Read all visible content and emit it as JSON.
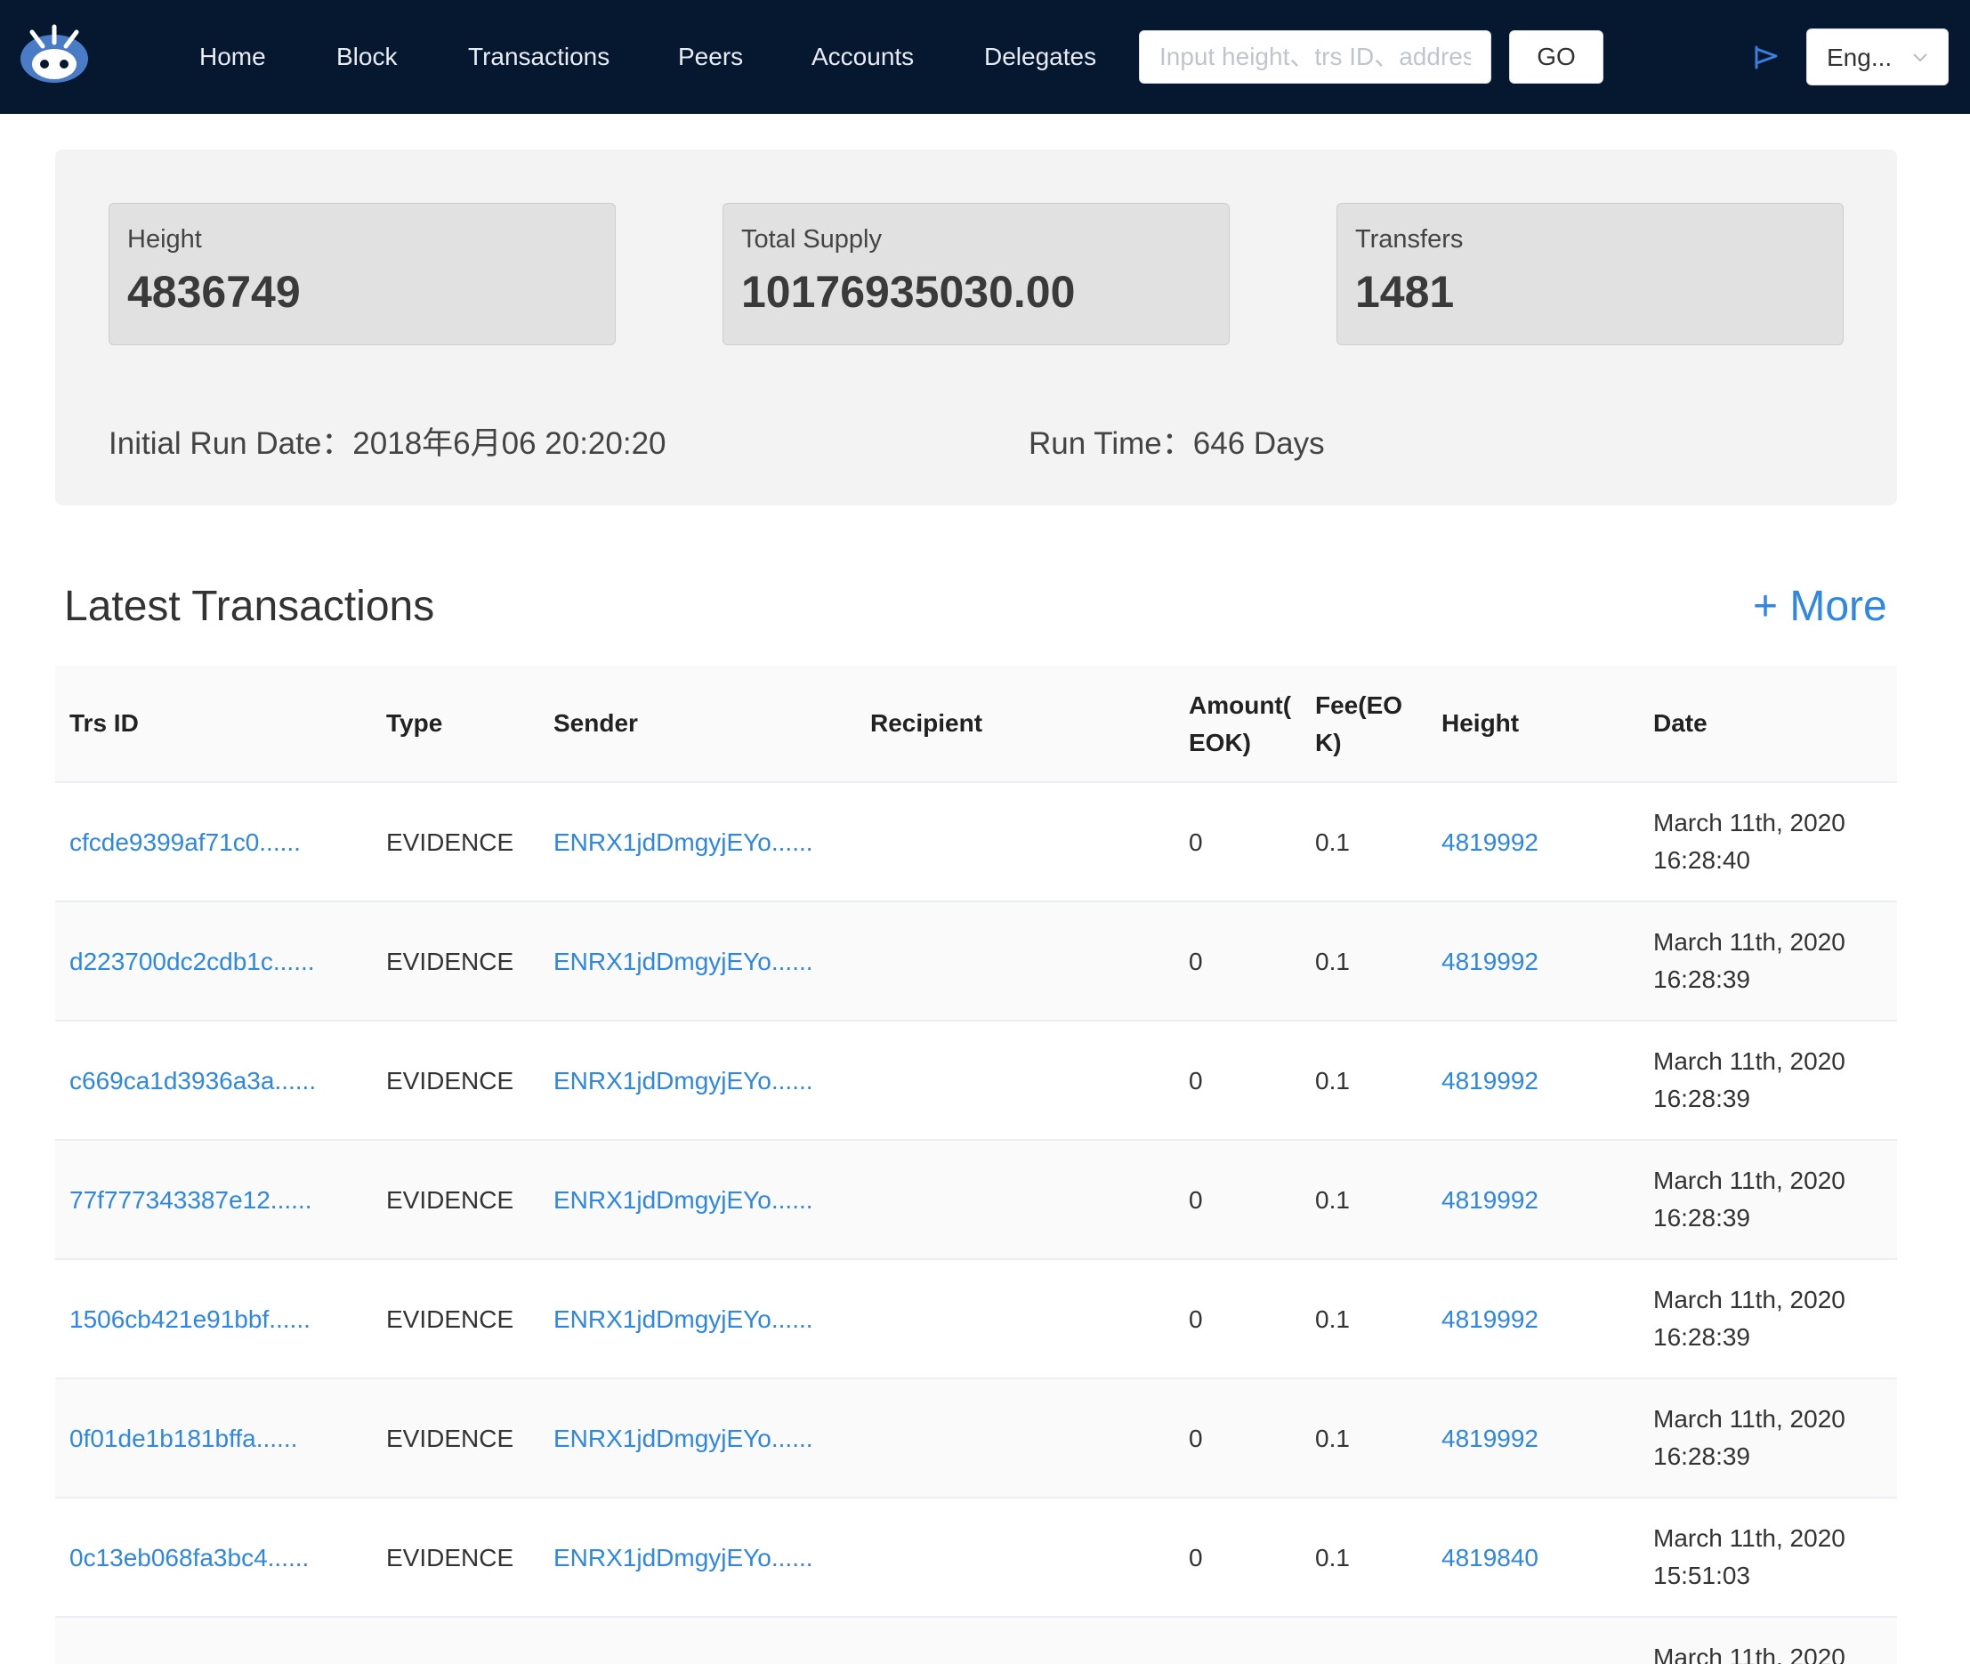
{
  "nav": {
    "items": [
      "Home",
      "Block",
      "Transactions",
      "Peers",
      "Accounts",
      "Delegates"
    ],
    "search_placeholder": "Input height、trs ID、address",
    "go_label": "GO",
    "language": "Eng..."
  },
  "stats": {
    "height_label": "Height",
    "height_value": "4836749",
    "supply_label": "Total Supply",
    "supply_value": "10176935030.00",
    "transfers_label": "Transfers",
    "transfers_value": "1481",
    "initial_run_label": "Initial Run Date：",
    "initial_run_value": "2018年6月06 20:20:20",
    "run_time_label": "Run Time：",
    "run_time_value": "646 Days"
  },
  "transactions": {
    "title": "Latest Transactions",
    "more_label": "+ More",
    "headers": {
      "trs_id": "Trs ID",
      "type": "Type",
      "sender": "Sender",
      "recipient": "Recipient",
      "amount_line1": "Amount(",
      "amount_line2": "EOK)",
      "fee_line1": "Fee(EO",
      "fee_line2": "K)",
      "height": "Height",
      "date": "Date"
    },
    "rows": [
      {
        "id": "cfcde9399af71c0......",
        "type": "EVIDENCE",
        "sender": "ENRX1jdDmgyjEYo......",
        "recipient": "",
        "amount": "0",
        "fee": "0.1",
        "height": "4819992",
        "date1": "March 11th, 2020",
        "date2": "16:28:40"
      },
      {
        "id": "d223700dc2cdb1c......",
        "type": "EVIDENCE",
        "sender": "ENRX1jdDmgyjEYo......",
        "recipient": "",
        "amount": "0",
        "fee": "0.1",
        "height": "4819992",
        "date1": "March 11th, 2020",
        "date2": "16:28:39"
      },
      {
        "id": "c669ca1d3936a3a......",
        "type": "EVIDENCE",
        "sender": "ENRX1jdDmgyjEYo......",
        "recipient": "",
        "amount": "0",
        "fee": "0.1",
        "height": "4819992",
        "date1": "March 11th, 2020",
        "date2": "16:28:39"
      },
      {
        "id": "77f777343387e12......",
        "type": "EVIDENCE",
        "sender": "ENRX1jdDmgyjEYo......",
        "recipient": "",
        "amount": "0",
        "fee": "0.1",
        "height": "4819992",
        "date1": "March 11th, 2020",
        "date2": "16:28:39"
      },
      {
        "id": "1506cb421e91bbf......",
        "type": "EVIDENCE",
        "sender": "ENRX1jdDmgyjEYo......",
        "recipient": "",
        "amount": "0",
        "fee": "0.1",
        "height": "4819992",
        "date1": "March 11th, 2020",
        "date2": "16:28:39"
      },
      {
        "id": "0f01de1b181bffa......",
        "type": "EVIDENCE",
        "sender": "ENRX1jdDmgyjEYo......",
        "recipient": "",
        "amount": "0",
        "fee": "0.1",
        "height": "4819992",
        "date1": "March 11th, 2020",
        "date2": "16:28:39"
      },
      {
        "id": "0c13eb068fa3bc4......",
        "type": "EVIDENCE",
        "sender": "ENRX1jdDmgyjEYo......",
        "recipient": "",
        "amount": "0",
        "fee": "0.1",
        "height": "4819840",
        "date1": "March 11th, 2020",
        "date2": "15:51:03"
      },
      {
        "id": "",
        "type": "",
        "sender": "",
        "recipient": "",
        "amount": "",
        "fee": "",
        "height": "",
        "date1": "March 11th, 2020",
        "date2": ""
      }
    ]
  },
  "colors": {
    "nav_bg": "#061730",
    "link": "#2e87e4",
    "panel_bg": "#f3f3f3",
    "card_bg": "#e1e1e1"
  },
  "icons": {
    "logo": "robot-logo-icon",
    "flag": "flag-icon",
    "chevron": "chevron-down-icon"
  }
}
